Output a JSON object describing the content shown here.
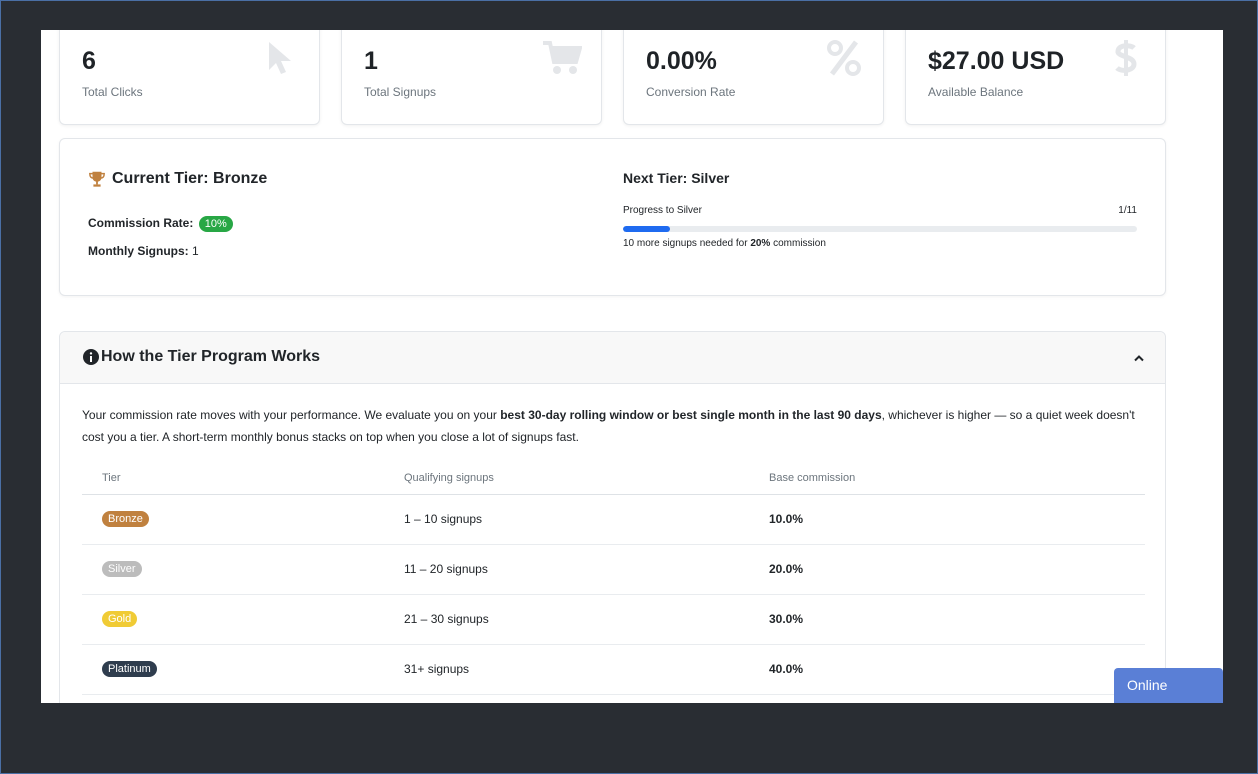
{
  "stats": [
    {
      "value": "6",
      "label": "Total Clicks",
      "icon": "cursor-icon"
    },
    {
      "value": "1",
      "label": "Total Signups",
      "icon": "cart-icon"
    },
    {
      "value": "0.00%",
      "label": "Conversion Rate",
      "icon": "percent-icon"
    },
    {
      "value": "$27.00 USD",
      "label": "Available Balance",
      "icon": "dollar-icon"
    }
  ],
  "tier": {
    "current_title": "Current Tier: Bronze",
    "commission_label": "Commission Rate:",
    "commission_value": "10%",
    "monthly_label": "Monthly Signups:",
    "monthly_value": "1",
    "next_title": "Next Tier: Silver",
    "progress_label": "Progress to Silver",
    "progress_count": "1/11",
    "progress_fraction": 0.0909,
    "note_prefix": "10 more signups needed for",
    "note_rate": "20%",
    "note_suffix": "commission"
  },
  "program": {
    "title": "How the Tier Program Works",
    "desc_1": "Your commission rate moves with your performance. We evaluate you on your",
    "desc_bold": "best 30-day rolling window or best single month in the last 90 days",
    "desc_2": ", whichever is higher — so a quiet week doesn't cost you a tier. A short-term monthly bonus stacks on top when you close a lot of signups fast.",
    "columns": [
      "Tier",
      "Qualifying signups",
      "Base commission"
    ],
    "rows": [
      {
        "tier": "Bronze",
        "color": "#c0813f",
        "signups": "1 – 10 signups",
        "rate": "10.0%"
      },
      {
        "tier": "Silver",
        "color": "#bcbcbc",
        "signups": "11 – 20 signups",
        "rate": "20.0%"
      },
      {
        "tier": "Gold",
        "color": "#f0cb35",
        "signups": "21 – 30 signups",
        "rate": "30.0%"
      },
      {
        "tier": "Platinum",
        "color": "#2f3d4e",
        "signups": "31+ signups",
        "rate": "40.0%"
      }
    ]
  },
  "chat": {
    "label": "Online"
  },
  "colors": {
    "accent": "#1f6bf0",
    "success": "#28a745",
    "chat": "#5a7fd6"
  }
}
